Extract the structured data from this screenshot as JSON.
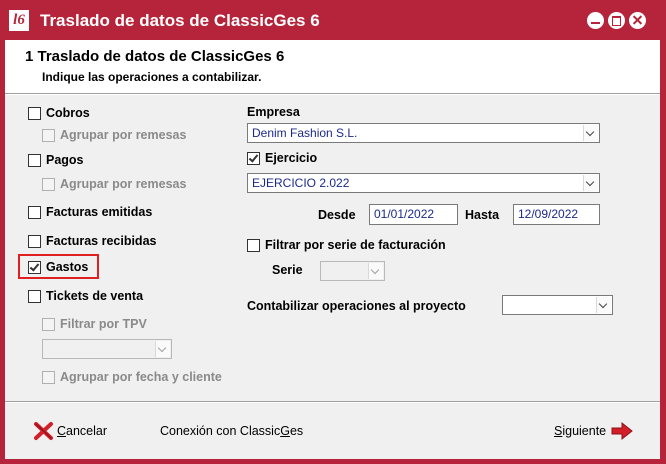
{
  "window": {
    "title": "Traslado de datos de ClassicGes 6",
    "logo_text": "l6"
  },
  "header": {
    "step_title": "1  Traslado de datos de ClassicGes 6",
    "subtitle": "Indique las operaciones a contabilizar."
  },
  "left": {
    "cobros": {
      "label": "Cobros",
      "checked": false
    },
    "cobros_agrupar": {
      "label": "Agrupar por remesas",
      "enabled": false
    },
    "pagos": {
      "label": "Pagos",
      "checked": false
    },
    "pagos_agrupar": {
      "label": "Agrupar por remesas",
      "enabled": false
    },
    "facturas_emitidas": {
      "label": "Facturas emitidas",
      "checked": false
    },
    "facturas_recibidas": {
      "label": "Facturas recibidas",
      "checked": false
    },
    "gastos": {
      "label": "Gastos",
      "checked": true
    },
    "tickets": {
      "label": "Tickets de venta",
      "checked": false
    },
    "filtrar_tpv": {
      "label": "Filtrar por TPV",
      "enabled": false
    },
    "tpv_select": {
      "value": ""
    },
    "agrupar_fecha": {
      "label": "Agrupar por fecha y cliente",
      "enabled": false
    }
  },
  "right": {
    "empresa_label": "Empresa",
    "empresa_value": "Denim Fashion S.L.",
    "ejercicio": {
      "label": "Ejercicio",
      "checked": true
    },
    "ejercicio_value": "EJERCICIO 2.022",
    "desde_label": "Desde",
    "desde_value": "01/01/2022",
    "hasta_label": "Hasta",
    "hasta_value": "12/09/2022",
    "filtrar_serie": {
      "label": "Filtrar por serie de facturación",
      "checked": false
    },
    "serie_label": "Serie",
    "serie_value": "",
    "proyecto_label": "Contabilizar operaciones al proyecto",
    "proyecto_value": ""
  },
  "footer": {
    "cancel_prefix": "",
    "cancel_underlined": "C",
    "cancel_rest": "ancelar",
    "conexion_prefix": "Conexión con Classic",
    "conexion_underlined": "G",
    "conexion_rest": "es",
    "next_underlined": "S",
    "next_rest": "iguiente"
  },
  "colors": {
    "title_bar": "#b5243a",
    "highlight": "#e02020",
    "field_text": "#1b2a8a"
  },
  "icons": {
    "cancel": "red-x-icon",
    "next": "red-arrow-right-icon"
  }
}
